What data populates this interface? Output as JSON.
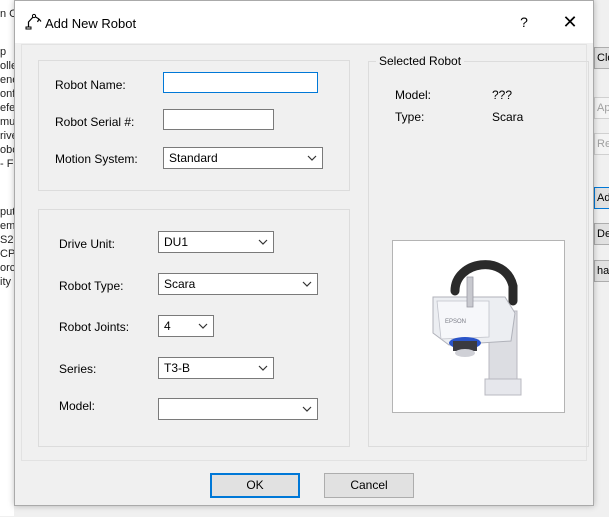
{
  "background": {
    "left_fragments": [
      "n C",
      "p",
      "olle",
      "ene",
      "onfi",
      "efe",
      "mu",
      "rive",
      "obo",
      "- F",
      "put",
      "em",
      "S2",
      "CP",
      "orce",
      "ity"
    ],
    "right_buttons": [
      "Clo",
      "Ap",
      "Res",
      "Ad",
      "Del",
      "han"
    ]
  },
  "dialog": {
    "title": "Add New Robot",
    "help_label": "?",
    "close_label": "✕",
    "robot_name": {
      "label": "Robot Name:",
      "value": ""
    },
    "robot_serial": {
      "label": "Robot Serial #:",
      "value": ""
    },
    "motion_system": {
      "label": "Motion System:",
      "value": "Standard"
    },
    "drive_unit": {
      "label": "Drive Unit:",
      "value": "DU1"
    },
    "robot_type": {
      "label": "Robot Type:",
      "value": "Scara"
    },
    "robot_joints": {
      "label": "Robot Joints:",
      "value": "4"
    },
    "series": {
      "label": "Series:",
      "value": "T3-B"
    },
    "model": {
      "label": "Model:",
      "value": ""
    },
    "selected_robot": {
      "title": "Selected Robot",
      "model_label": "Model:",
      "model_value": "???",
      "type_label": "Type:",
      "type_value": "Scara",
      "image_logo": "EPSON"
    },
    "ok_label": "OK",
    "cancel_label": "Cancel"
  },
  "colors": {
    "accent": "#0078d7",
    "dialog_bg": "#f0f0f0",
    "robot_white": "#e8e8ec",
    "robot_arm": "#2a2a2a",
    "robot_blue": "#2a54c8"
  }
}
